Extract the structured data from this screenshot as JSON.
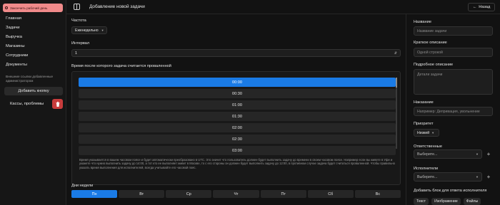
{
  "sidebar": {
    "top_button": "Закончить рабочий день",
    "nav": [
      "Главная",
      "Задачи",
      "Выручка",
      "Магазины",
      "Сотрудники",
      "Документы"
    ],
    "external_links_label": "Внешние ссылки добавленные администратором",
    "add_button": "Добавить кнопку",
    "kassy_label": "Кассы, проблемы"
  },
  "header": {
    "title": "Добавление новой задачи",
    "back_label": "Назад"
  },
  "main": {
    "frequency_label": "Частота",
    "frequency_value": "Еженедельно",
    "interval_label": "Интервал",
    "interval_value": "1",
    "failed_time_label": "Время после которого задача считается проваленной",
    "times": [
      "00:00",
      "00:30",
      "01:00",
      "01:30",
      "02:00",
      "02:30",
      "03:00"
    ],
    "selected_time": "00:00",
    "note": "Время указывается в вашем часовом поясе и будет автоматически преобразовано в UTC. Это значит что пользователь должен будет выполнить задачу до времени в своем часовом поясе. Например если вы живете в Уфе и укажете что нужно выполнить задачу до 14:00, а тот кто ее выполняет живет в Москве, то с его стороны он должен будет выполнить задачу до 12:00, в противном случае задача будет считаться проваленной. Чтобы правильно указать время выполнения для исполнителей, всегда учитывайте его часовой пояс.",
    "days_label": "Дни недели",
    "days": [
      "Пн",
      "Вт",
      "Ср",
      "Чт",
      "Пт",
      "Сб",
      "Вс"
    ],
    "selected_day": "Пн"
  },
  "right_panel": {
    "name_label": "Название",
    "name_placeholder": "Название задачи",
    "short_label": "Краткое описание",
    "short_placeholder": "Одной строкой",
    "detail_label": "Подробное описание",
    "detail_placeholder": "Детали задачи",
    "punish_label": "Наказание",
    "punish_placeholder": "Например: Депривация, увольнение",
    "priority_label": "Приоритет",
    "priority_value": "Низкий",
    "responsible_label": "Ответственные",
    "responsible_placeholder": "Выберите...",
    "executors_label": "Исполнители",
    "executors_placeholder": "Выберите...",
    "add_block_label": "Добавить блок для ответа исполнителя",
    "block_buttons": [
      "Текст",
      "Изображение",
      "Файлы"
    ]
  },
  "colors": {
    "accent": "#1a7be6",
    "danger": "#c83c3c",
    "pill": "#f08a8a"
  }
}
